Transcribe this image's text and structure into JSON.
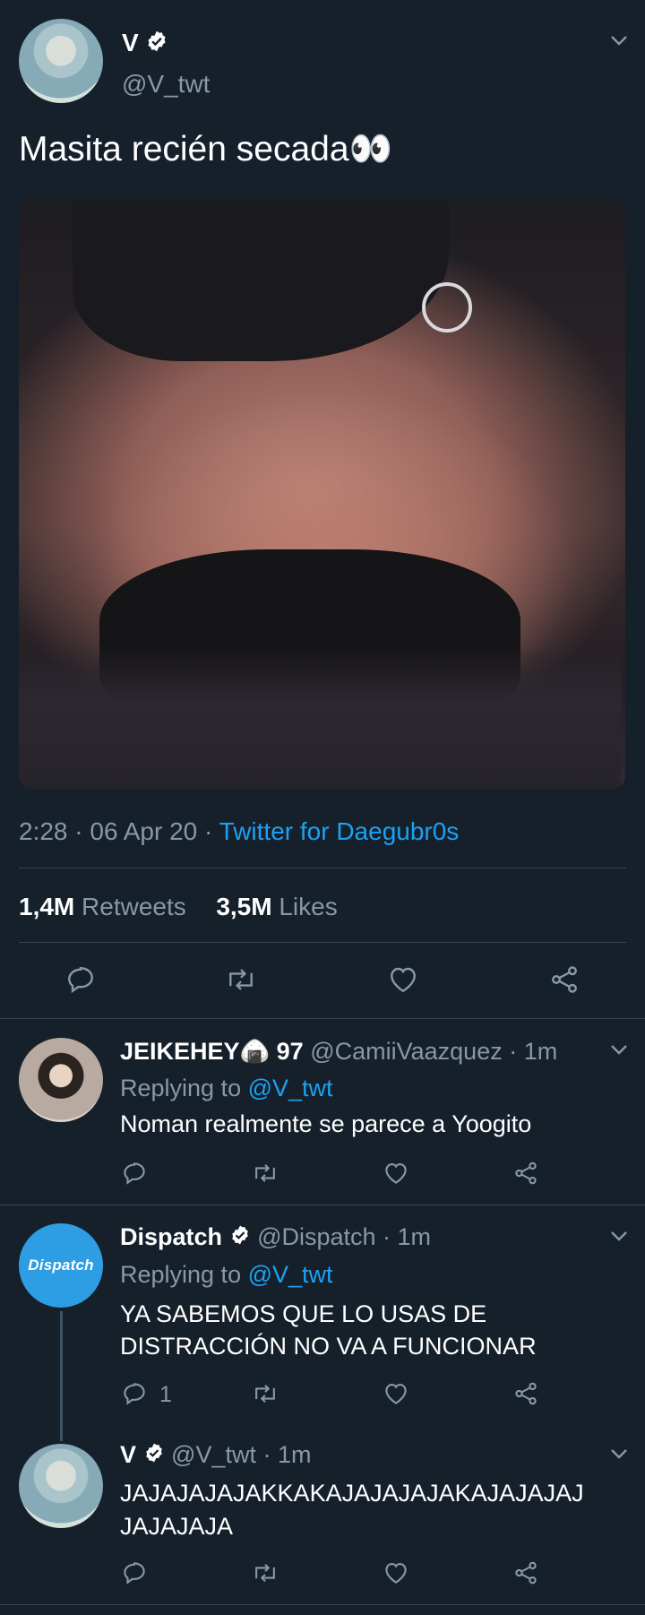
{
  "main_tweet": {
    "author_name": "V",
    "author_handle": "@V_twt",
    "text": "Masita recién secada👀",
    "timestamp": "2:28 · 06 Apr 20 · ",
    "source": "Twitter for Daegubr0s",
    "retweets_count": "1,4M",
    "retweets_label": "Retweets",
    "likes_count": "3,5M",
    "likes_label": "Likes"
  },
  "replies": [
    {
      "author_name": "JEIKEHEY🍙 97",
      "author_handle": "@CamiiVaazquez",
      "time": "· 1m",
      "replying_prefix": "Replying to ",
      "replying_to": "@V_twt",
      "text": "Noman realmente se parece a Yoogito",
      "reply_count": ""
    },
    {
      "author_name": "Dispatch",
      "author_handle": "@Dispatch",
      "time": "· 1m",
      "avatar_text": "Dispatch",
      "replying_prefix": "Replying to ",
      "replying_to": "@V_twt",
      "text_line1": "YA SABEMOS QUE LO USAS DE",
      "text_line2": "DISTRACCIÓN NO VA A FUNCIONAR",
      "reply_count": "1"
    },
    {
      "author_name": "V",
      "author_handle": "@V_twt",
      "time": "· 1m",
      "text_line1": "JAJAJAJAJAKKAKAJAJAJAJAKAJAJAJAJ",
      "text_line2": "JAJAJAJA",
      "reply_count": ""
    }
  ],
  "colors": {
    "background": "#15202b",
    "link": "#1da1f2",
    "muted": "#8899a6",
    "divider": "#38444d"
  },
  "icons": [
    "chevron-down-icon",
    "verified-badge-icon",
    "reply-icon",
    "retweet-icon",
    "like-icon",
    "share-icon"
  ]
}
